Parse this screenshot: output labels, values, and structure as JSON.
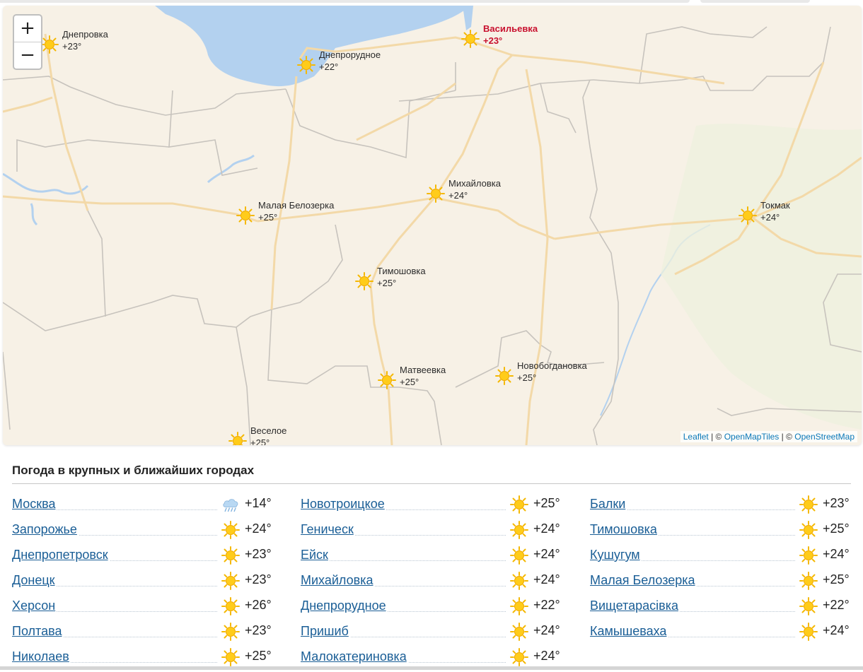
{
  "map": {
    "zoom_in_label": "+",
    "zoom_out_label": "−",
    "markers": [
      {
        "name": "Днепровка",
        "temp": "+23°",
        "icon": "sun-icon",
        "highlight": false
      },
      {
        "name": "Днепрорудное",
        "temp": "+22°",
        "icon": "sun-icon",
        "highlight": false
      },
      {
        "name": "Васильевка",
        "temp": "+23°",
        "icon": "sun-icon",
        "highlight": true
      },
      {
        "name": "Михайловка",
        "temp": "+24°",
        "icon": "sun-icon",
        "highlight": false
      },
      {
        "name": "Малая Белозерка",
        "temp": "+25°",
        "icon": "sun-icon",
        "highlight": false
      },
      {
        "name": "Токмак",
        "temp": "+24°",
        "icon": "sun-icon",
        "highlight": false
      },
      {
        "name": "Тимошовка",
        "temp": "+25°",
        "icon": "sun-icon",
        "highlight": false
      },
      {
        "name": "Матвеевка",
        "temp": "+25°",
        "icon": "sun-icon",
        "highlight": false
      },
      {
        "name": "Новобогдановка",
        "temp": "+25°",
        "icon": "sun-icon",
        "highlight": false
      },
      {
        "name": "Веселое",
        "temp": "+25°",
        "icon": "sun-icon",
        "highlight": false
      }
    ],
    "attribution": {
      "leaflet": "Leaflet",
      "sep1": " | © ",
      "openmaptiles": "OpenMapTiles",
      "sep2": " | © ",
      "openstreetmap": "OpenStreetMap"
    },
    "colors": {
      "highlight": "#c8102e",
      "water": "#b3d1ef",
      "land": "#f7f1e6",
      "roads": "#f3d9a8"
    }
  },
  "section": {
    "title": "Погода в крупных и ближайших городах",
    "columns": [
      [
        {
          "city": "Москва",
          "temp": "+14°",
          "icon": "rain-cloud-icon"
        },
        {
          "city": "Запорожье",
          "temp": "+24°",
          "icon": "sun-icon"
        },
        {
          "city": "Днепропетровск",
          "temp": "+23°",
          "icon": "sun-icon"
        },
        {
          "city": "Донецк",
          "temp": "+23°",
          "icon": "sun-icon"
        },
        {
          "city": "Херсон",
          "temp": "+26°",
          "icon": "sun-icon"
        },
        {
          "city": "Полтава",
          "temp": "+23°",
          "icon": "sun-icon"
        },
        {
          "city": "Николаев",
          "temp": "+25°",
          "icon": "sun-icon"
        }
      ],
      [
        {
          "city": "Новотроицкое",
          "temp": "+25°",
          "icon": "sun-icon"
        },
        {
          "city": "Геническ",
          "temp": "+24°",
          "icon": "sun-icon"
        },
        {
          "city": "Ейск",
          "temp": "+24°",
          "icon": "sun-icon"
        },
        {
          "city": "Михайловка",
          "temp": "+24°",
          "icon": "sun-icon"
        },
        {
          "city": "Днепрорудное",
          "temp": "+22°",
          "icon": "sun-icon"
        },
        {
          "city": "Пришиб",
          "temp": "+24°",
          "icon": "sun-icon"
        },
        {
          "city": "Малокатериновка",
          "temp": "+24°",
          "icon": "sun-icon"
        }
      ],
      [
        {
          "city": "Балки",
          "temp": "+23°",
          "icon": "sun-icon"
        },
        {
          "city": "Тимошовка",
          "temp": "+25°",
          "icon": "sun-icon"
        },
        {
          "city": "Кушугум",
          "temp": "+24°",
          "icon": "sun-icon"
        },
        {
          "city": "Малая Белозерка",
          "temp": "+25°",
          "icon": "sun-icon"
        },
        {
          "city": "Вищетарасівка",
          "temp": "+22°",
          "icon": "sun-icon"
        },
        {
          "city": "Камышеваха",
          "temp": "+24°",
          "icon": "sun-icon"
        }
      ]
    ]
  }
}
